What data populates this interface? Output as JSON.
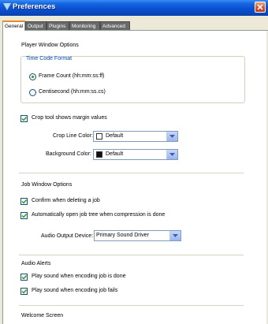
{
  "window": {
    "title": "Preferences"
  },
  "tabs": [
    "General",
    "Output",
    "Plugins",
    "Monitoring",
    "Advanced"
  ],
  "player_window": {
    "section_title": "Player Window Options",
    "time_code": {
      "title": "Time Code Format",
      "options": [
        "Frame Count (hh:mm:ss:ff)",
        "Centisecond (hh:mm:ss.cs)"
      ],
      "selected": "Frame Count (hh:mm:ss:ff)"
    },
    "crop_margin_label": "Crop tool shows margin values",
    "crop_line_color": {
      "label": "Crop Line Color:",
      "value": "Default",
      "swatch": "#ffffff"
    },
    "background_color": {
      "label": "Background Color:",
      "value": "Default",
      "swatch": "#101010"
    }
  },
  "job_window": {
    "section_title": "Job Window Options",
    "confirm_delete_label": "Confirm when deleting a job",
    "auto_open_label": "Automatically open job tree when compression is done",
    "audio_device": {
      "label": "Audio Output Device:",
      "value": "Primary Sound Driver"
    }
  },
  "audio_alerts": {
    "section_title": "Audio Alerts",
    "done_label": "Play sound when encoding job is done",
    "fail_label": "Play sound when encoding job fails"
  },
  "welcome": {
    "section_title": "Welcome Screen"
  },
  "colors": {
    "accent": "#0046d5",
    "title_bar": "#0a4fd0",
    "check_mark": "#21a121"
  }
}
